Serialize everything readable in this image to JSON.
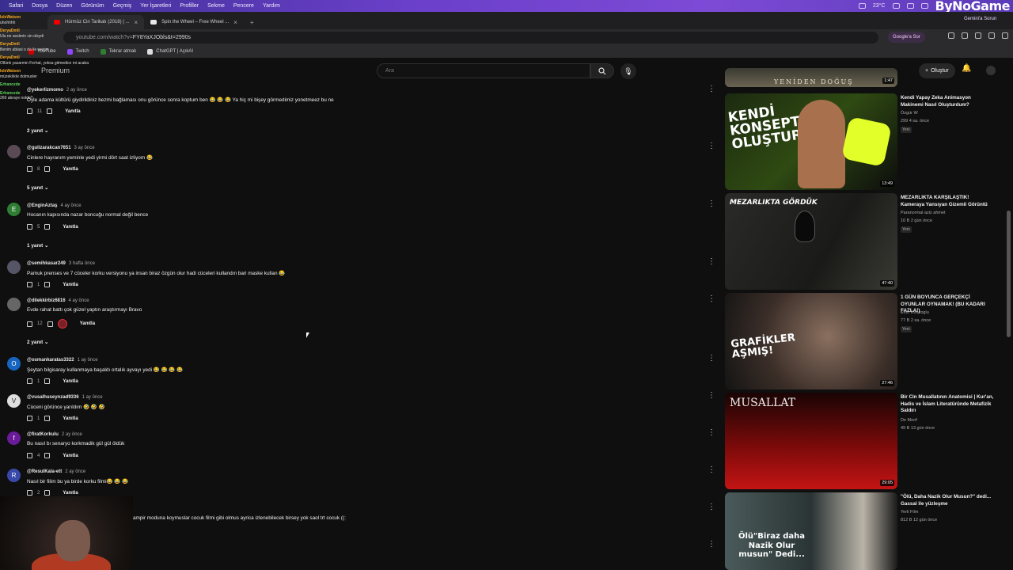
{
  "menubar": {
    "items": [
      "Safari",
      "Dosya",
      "Düzen",
      "Görünüm",
      "Geçmiş",
      "Yer İşaretleri",
      "Profiller",
      "Sekme",
      "Pencere",
      "Yardım"
    ],
    "temperature": "23°C",
    "brand": "ByNoGame"
  },
  "tabs": [
    {
      "label": "Hürmüz Cin Tarikatı (2018) | ...",
      "active": true
    },
    {
      "label": "Spin the Wheel – Free Wheel ...",
      "active": false
    }
  ],
  "address": {
    "url_prefix": "youtube.com/watch?v=",
    "url_rest": "FY8YaXJObls&t=2990s",
    "gemini_label": "Google'a Sor",
    "gemini_side": "Gemini'a Sorun"
  },
  "bookmarks": [
    "YouTube",
    "Twitch",
    "Tekrar atmak",
    "ChatGPT | AçıkAI"
  ],
  "header": {
    "premium": "Premium",
    "search_placeholder": "Ara",
    "create_label": "Oluştur"
  },
  "chat_overlay": [
    {
      "user": "IsleWatson",
      "msg": "uhohhhh"
    },
    {
      "user": "DeryaDmll",
      "msg": "Ulu ne seslerin cin olsydi"
    },
    {
      "user": "DeryaDmll",
      "msg": "Benim ablasi o da ile seviye"
    },
    {
      "user": "DeryaDmll",
      "msg": "Ollünk yasarmin Ferhat, yoksa gitmedice mi acaba"
    },
    {
      "user": "IsleWatson",
      "msg": "müzeklıkte dolmusler"
    },
    {
      "user": "Erhanozde",
      "msg": ""
    },
    {
      "user": "Erhanozde",
      "msg": "269 abraye noktu?"
    }
  ],
  "comments": [
    {
      "handle": "@yekerlizmomo",
      "time": "2 ay önce",
      "text": "Öyle adama kültürü giydirildiniz bezmi bağlaması onu görünce  sonra koptum ben 😂 😂 😂  Ya hiç mi bişey görmedimiz yonetmeez bu ne",
      "likes": "11",
      "replies": "2 yanıt",
      "avatar": "",
      "color": "#444"
    },
    {
      "handle": "@gulizarakcan7651",
      "time": "3 ay önce",
      "text": "Cinlere hayranım yeminle yedi yirmi dört saat izliyom 😂",
      "likes": "8",
      "replies": "5 yanıt",
      "avatar": "",
      "color": "#5a4a55"
    },
    {
      "handle": "@EnginAztaş",
      "time": "4 ay önce",
      "text": "Hocanın kapısında nazar boncuğu normal değil bence",
      "likes": "5",
      "replies": "1 yanıt",
      "avatar": "E",
      "color": "#2e7d32"
    },
    {
      "handle": "@semihkasar249",
      "time": "3 hafta önce",
      "text": "Pamuk prenses ve 7 cüceler korku versiyonu ya insan biraz özgün olur hadi cüceleri kullandın bari maske kullan 😂",
      "likes": "1",
      "replies": "",
      "avatar": "",
      "color": "#556"
    },
    {
      "handle": "@dilekkirbiz6816",
      "time": "4 ay önce",
      "text": "Evde rahat battı çok güzel yaptın araştırmayı Bravo",
      "likes": "12",
      "replies": "2 yanıt",
      "avatar": "",
      "color": "#666"
    },
    {
      "handle": "@osmankaratas3322",
      "time": "1 ay önce",
      "text": "Şeytan bilgisaray kullanmaya başaldı ortalık ayvayı yedi 😂 😂 😂 😂",
      "likes": "1",
      "replies": "",
      "avatar": "O",
      "color": "#1565c0"
    },
    {
      "handle": "@vusalhuseynzad9336",
      "time": "1 ay önce",
      "text": "Cüceni görünce yarıldım 🤣 🤣 🤣",
      "likes": "1",
      "replies": "",
      "avatar": "V",
      "color": "#ddd"
    },
    {
      "handle": "@firatKorkulu",
      "time": "2 ay önce",
      "text": "Bu nasıl bı senaryo korkmadik gül gül öldük",
      "likes": "4",
      "replies": "",
      "avatar": "f",
      "color": "#6a1b9a"
    },
    {
      "handle": "@ResulKala-ett",
      "time": "2 ay önce",
      "text": "Nasıl bir filim bu ya birde korku filmi😂 😂 😂",
      "likes": "2",
      "replies": "",
      "avatar": "R",
      "color": "#3949ab"
    }
  ],
  "bottom_comment": "ampir moduna koymuslar cocuk filmi gibi olmus ayrica izlenebilecek birsey yok saol trt cocuk ((:",
  "comment_actions": {
    "reply": "Yanıtla"
  },
  "videos": [
    {
      "thumb_text": "YENİDEN DOĞUŞ",
      "duration": "1:47",
      "title": "",
      "channel": "",
      "meta": "",
      "badge": ""
    },
    {
      "thumb_text": "KENDİ KONSEPTİNİ OLUŞTUR",
      "duration": "13:49",
      "title": "Kendi Yapay Zeka Animasyon Makinemi Nasıl Oluşturdum?",
      "channel": "Özgür W",
      "meta": "299  4 sa. önce",
      "badge": "Yeni"
    },
    {
      "thumb_text": "MEZARLIKTA GÖRDÜK",
      "duration": "47:40",
      "title": "MEZARLIKTA KARŞILAŞTIK! Kameraya Yansıyan Gizemli Görüntü",
      "channel": "Paranormal aziz ahmet",
      "meta": "10 B  2 gün önce",
      "badge": "Yeni"
    },
    {
      "thumb_text": "GRAFİKLER AŞMIŞ!",
      "duration": "27:46",
      "title": "1 GÜN BOYUNCA GERÇEKÇİ OYUNLAR OYNAMAK! (BU KADARI FAZLA!)",
      "channel": "Emir Kirazoglu",
      "meta": "77 B  2 sa. önce",
      "badge": "Yeni"
    },
    {
      "thumb_text": "MUSALLAT",
      "duration": "29:05",
      "title": "Bir Cin Musallatının Anatomisi | Kur'an, Hadis ve İslam Literatüründe Metafizik Saldırı",
      "channel": "De Monf",
      "meta": "49 B  13 gün önce",
      "badge": ""
    },
    {
      "thumb_text": "Ölü\"Biraz daha Nazik Olur musun\" Dedi...",
      "duration": "",
      "title": "\"Ölü, Daha Nazik Olur Musun?\" dedi... Gassal ile yüzleşme",
      "channel": "Yerli Film",
      "meta": "812 B  12 gün önce",
      "badge": ""
    }
  ]
}
